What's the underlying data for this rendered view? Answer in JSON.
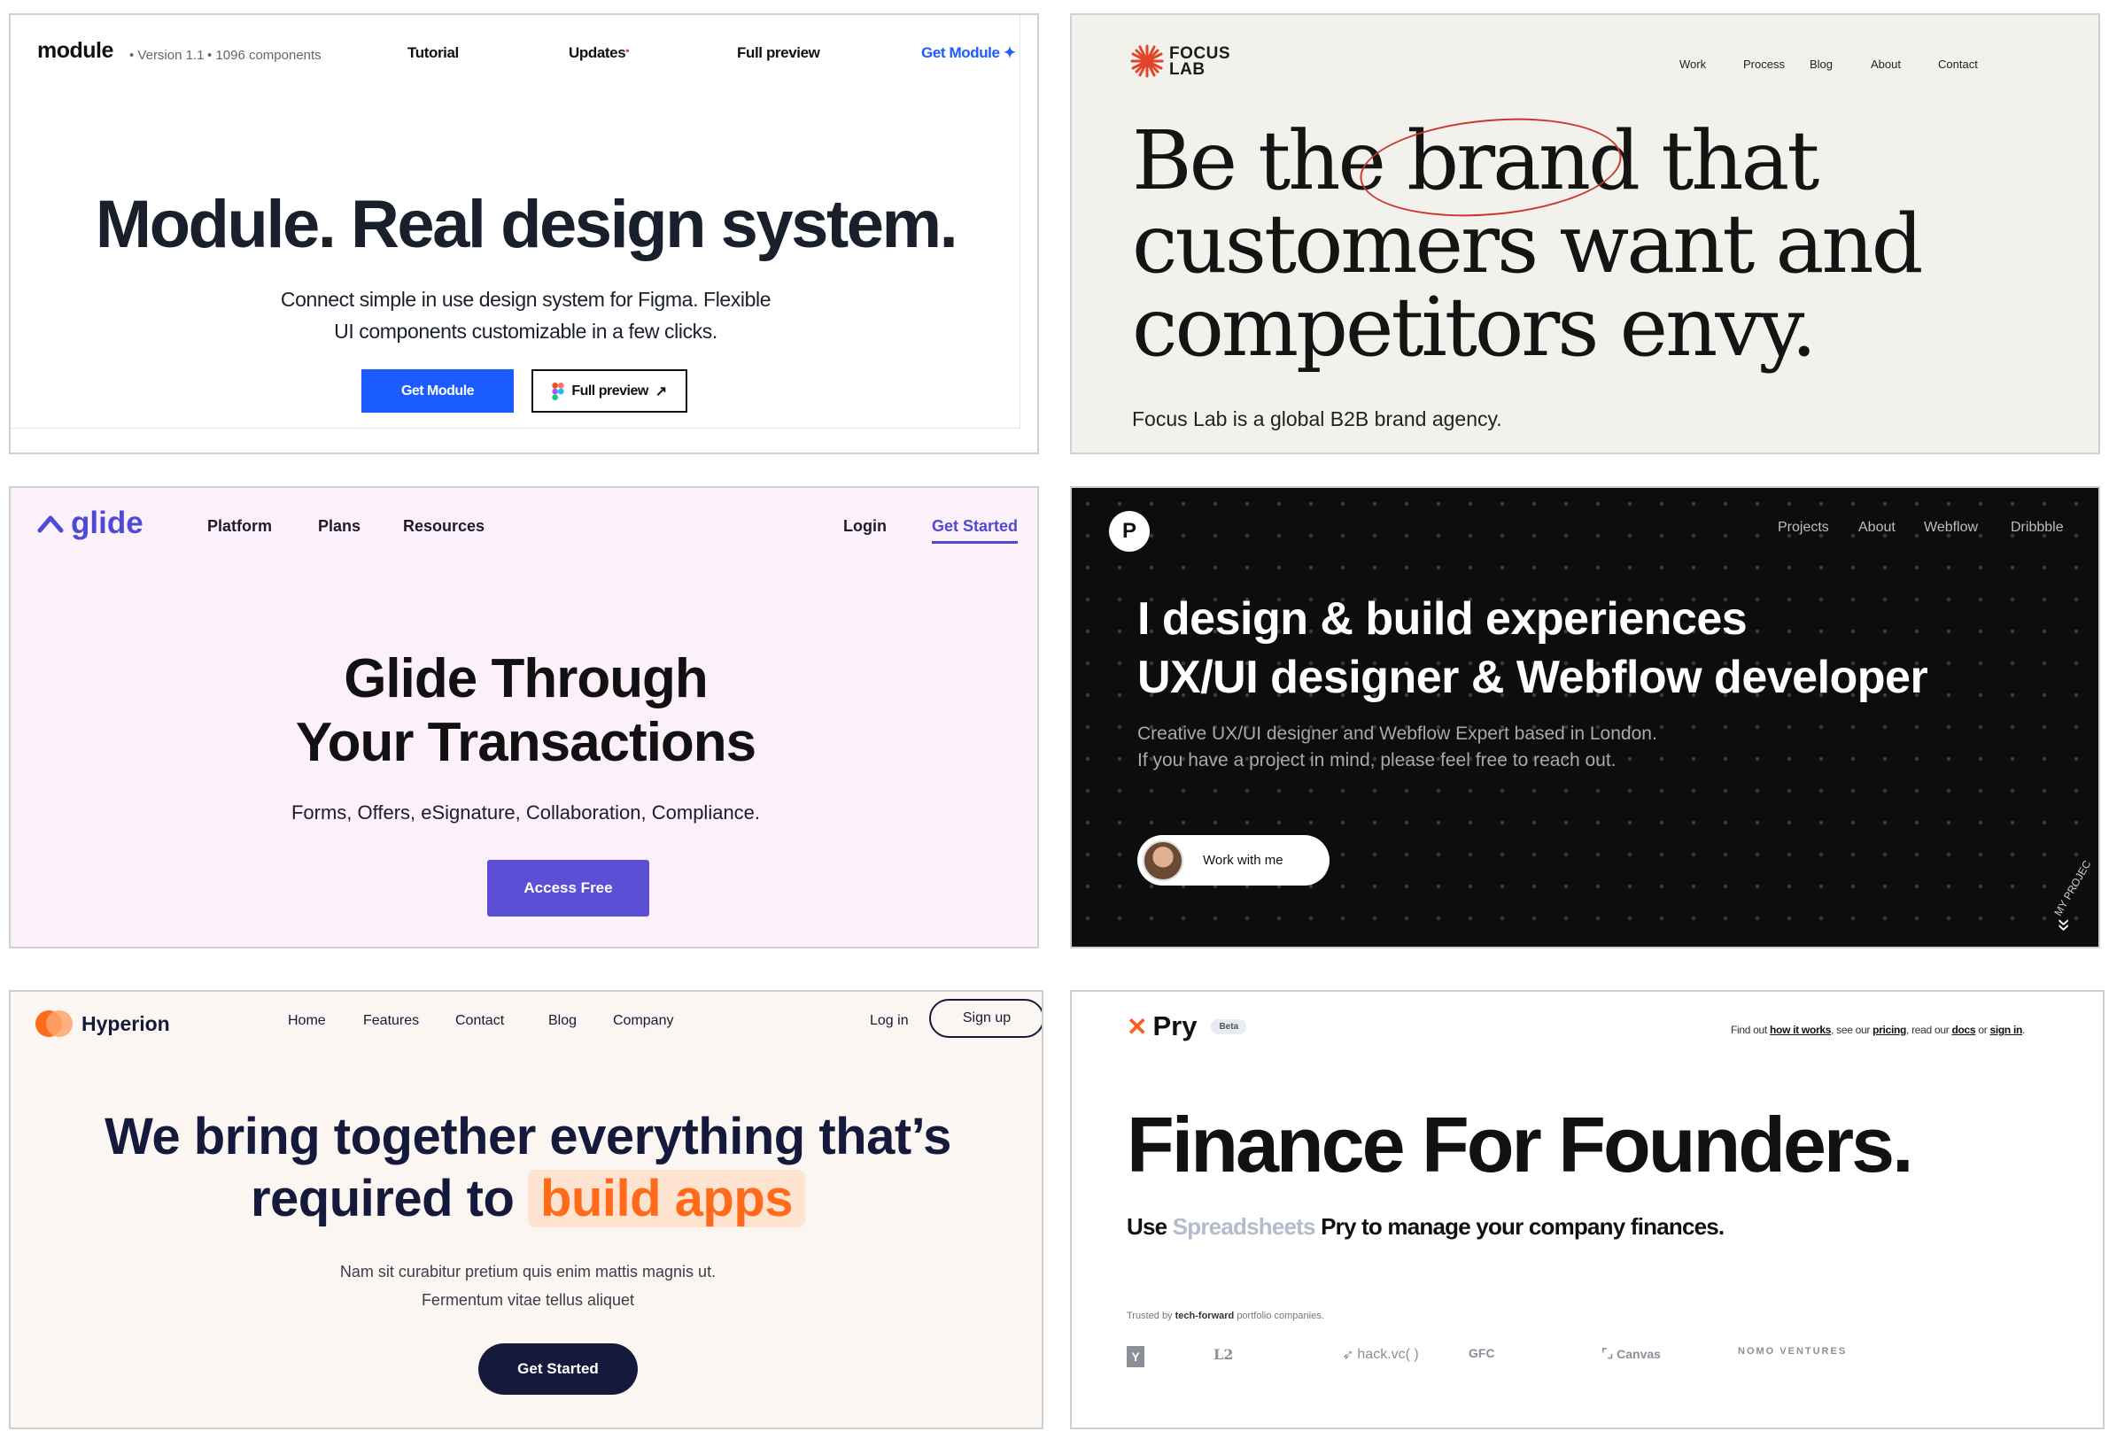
{
  "module": {
    "logo": "module",
    "version": "• Version 1.1",
    "components": "• 1096 components",
    "nav": [
      "Tutorial",
      "Updates",
      "Full preview"
    ],
    "updates_dot": "•",
    "cta_link": "Get Module",
    "cta_plus": "✦",
    "headline": "Module. Real design system.",
    "sub_line1": "Connect simple in use design system for Figma. Flexible",
    "sub_line2": "UI components customizable in a few clicks.",
    "btn_primary": "Get Module",
    "btn_secondary": "Full preview",
    "btn_secondary_arrow": "↗",
    "accent": "#1a5cff"
  },
  "focuslab": {
    "brand": "FOCUS LAB",
    "nav": [
      "Work",
      "Process",
      "Blog",
      "About",
      "Contact"
    ],
    "headline": "Be the brand that customers want and competitors envy.",
    "tagline": "Focus Lab is a global B2B brand agency.",
    "accent": "#e2432a"
  },
  "glide": {
    "logo": "glide",
    "nav": [
      "Platform",
      "Plans",
      "Resources"
    ],
    "login": "Login",
    "get_started": "Get Started",
    "headline_line1": "Glide Through",
    "headline_line2": "Your Transactions",
    "sub": "Forms, Offers, eSignature, Collaboration, Compliance.",
    "btn": "Access Free",
    "accent": "#5b4fd6"
  },
  "portfolio": {
    "logo": "P",
    "nav": [
      "Projects",
      "About",
      "Webflow",
      "Dribbble"
    ],
    "headline_line1": "I design & build experiences",
    "headline_line2": "UX/UI designer & Webflow developer",
    "sub_line1": "Creative UX/UI designer and Webflow Expert based in London.",
    "sub_line2": "If you have a project in mind, please feel free to reach out.",
    "btn": "Work with me",
    "arc_text": "MY PROJEC",
    "scroll": "»"
  },
  "hyperion": {
    "logo": "Hyperion",
    "nav": [
      "Home",
      "Features",
      "Contact",
      "Blog",
      "Company"
    ],
    "login": "Log in",
    "signup": "Sign up",
    "headline_line1": "We bring together everything that’s",
    "headline_line2_pre": "required to",
    "headline_highlight": "build apps",
    "sub_line1": "Nam sit curabitur pretium quis enim mattis magnis ut.",
    "sub_line2": "Fermentum vitae tellus aliquet",
    "btn": "Get Started",
    "accent": "#ff6b1a"
  },
  "pry": {
    "logo_mark": "✕",
    "logo": "Pry",
    "beta": "Beta",
    "top_pre": "Find out",
    "top_how": "how it works",
    "top_mid1": ", see our",
    "top_pricing": "pricing",
    "top_mid2": ", read our",
    "top_docs": "docs",
    "top_or": "or",
    "top_signin": "sign in",
    "top_end": ".",
    "headline": "Finance For Founders.",
    "sub_use": "Use",
    "sub_spread": "Spreadsheets",
    "sub_rest": "Pry to manage your company finances.",
    "trusted_pre": "Trusted by",
    "trusted_bold": "tech-forward",
    "trusted_post": "portfolio companies.",
    "logos": [
      "Y",
      "L2",
      "hack.vc( )",
      "GFC",
      "Canvas",
      "NOMO VENTURES"
    ]
  }
}
